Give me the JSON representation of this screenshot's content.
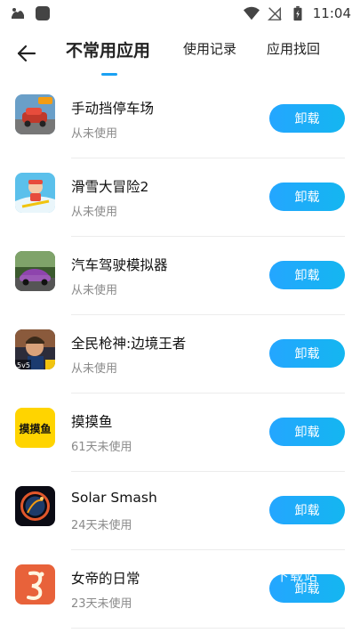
{
  "status_bar": {
    "time": "11:04"
  },
  "header": {
    "tabs": [
      {
        "label": "不常用应用",
        "active": true
      },
      {
        "label": "使用记录",
        "active": false
      },
      {
        "label": "应用找回",
        "active": false
      }
    ]
  },
  "apps": [
    {
      "name": "手动挡停车场",
      "usage": "从未使用",
      "button": "卸载",
      "icon": "parking-car-game-icon"
    },
    {
      "name": "滑雪大冒险2",
      "usage": "从未使用",
      "button": "卸载",
      "icon": "ski-adventure-icon"
    },
    {
      "name": "汽车驾驶模拟器",
      "usage": "从未使用",
      "button": "卸载",
      "icon": "purple-car-icon"
    },
    {
      "name": "全民枪神:边境王者",
      "usage": "从未使用",
      "button": "卸载",
      "icon": "shooter-hero-icon"
    },
    {
      "name": "摸摸鱼",
      "usage": "61天未使用",
      "button": "卸载",
      "icon": "momoyu-logo-icon"
    },
    {
      "name": "Solar Smash",
      "usage": "24天未使用",
      "button": "卸载",
      "icon": "planet-explosion-icon"
    },
    {
      "name": "女帝的日常",
      "usage": "23天未使用",
      "button": "卸载",
      "icon": "orange-emblem-icon"
    }
  ],
  "icon_labels": {
    "momoyu": "摸摸鱼",
    "shooter_badge": "5v5"
  },
  "watermark": "下载站",
  "colors": {
    "accent": "#1aa1f3",
    "button_start": "#24a6ff",
    "button_end": "#14b6f0",
    "secondary_text": "#8a8a8a"
  }
}
